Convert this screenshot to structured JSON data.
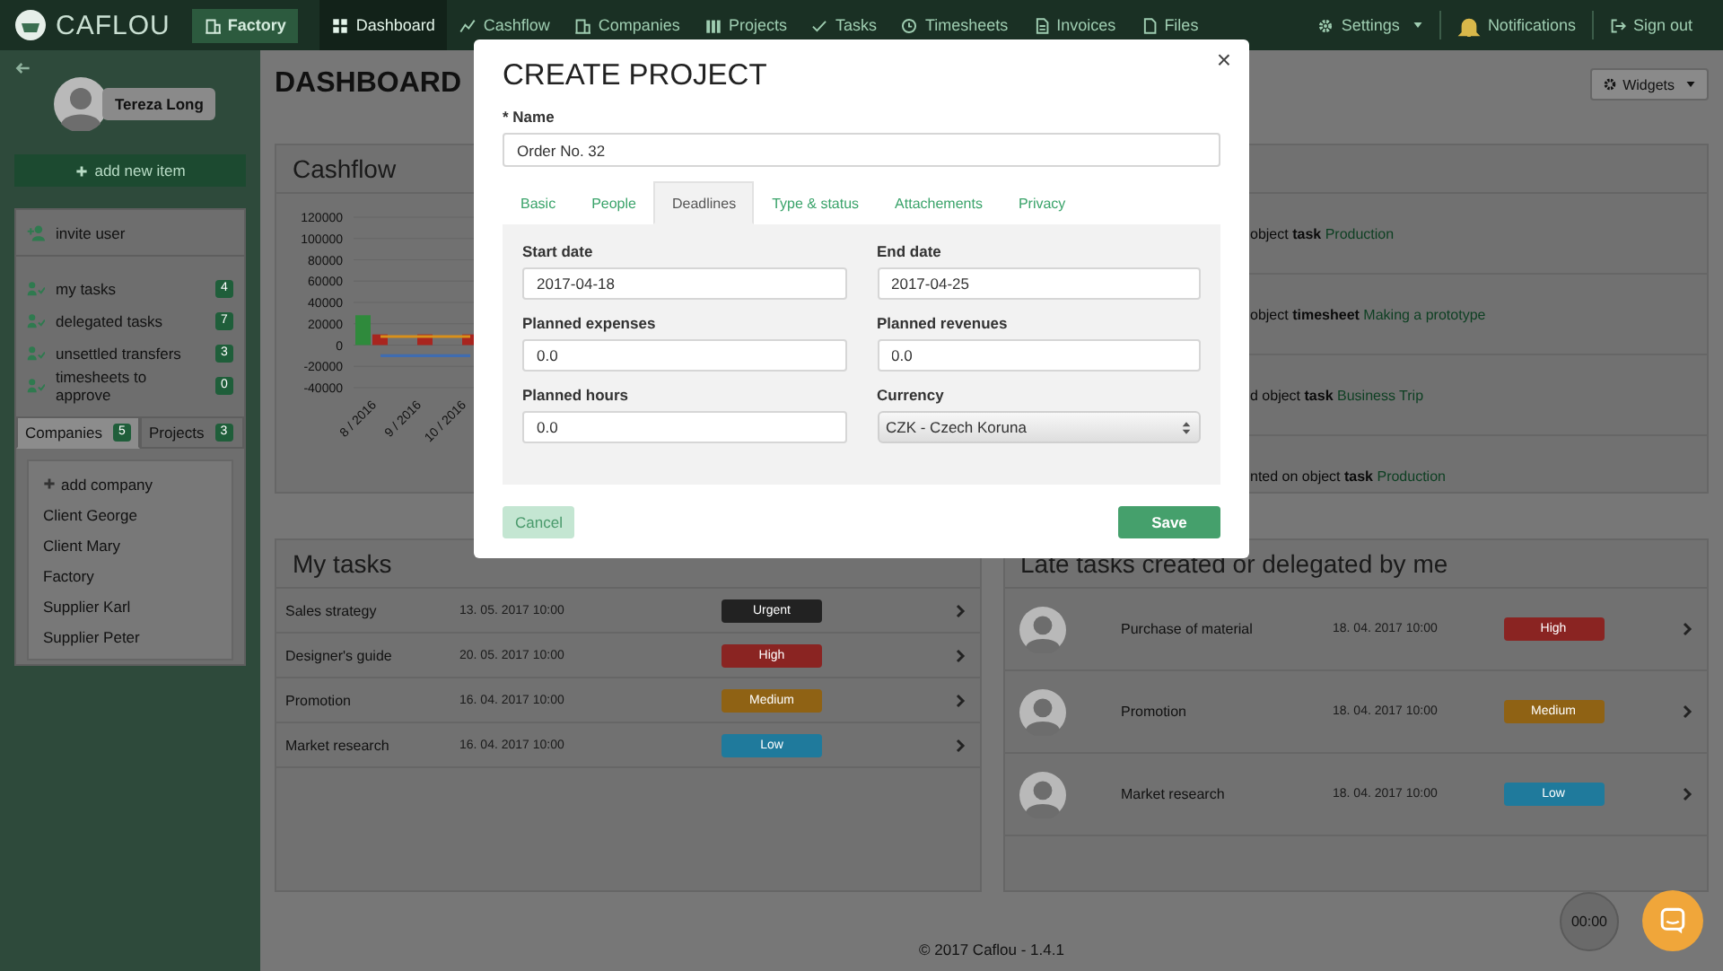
{
  "nav": {
    "logo": "CAFLOU",
    "company": "Factory",
    "items": [
      {
        "label": "Dashboard",
        "selected": true
      },
      {
        "label": "Cashflow",
        "selected": false
      },
      {
        "label": "Companies",
        "selected": false
      },
      {
        "label": "Projects",
        "selected": false
      },
      {
        "label": "Tasks",
        "selected": false
      },
      {
        "label": "Timesheets",
        "selected": false
      },
      {
        "label": "Invoices",
        "selected": false
      },
      {
        "label": "Files",
        "selected": false
      }
    ],
    "settings": "Settings",
    "notifications": "Notifications",
    "sign_out": "Sign out"
  },
  "sidebar": {
    "user": "Tereza Long",
    "add_button": "add new item",
    "invite": "invite user",
    "counters": [
      {
        "label": "my tasks",
        "count": "4"
      },
      {
        "label": "delegated tasks",
        "count": "7"
      },
      {
        "label": "unsettled transfers",
        "count": "3"
      },
      {
        "label": "timesheets to approve",
        "count": "0"
      }
    ],
    "tabs": [
      {
        "label": "Companies",
        "count": "5",
        "selected": true
      },
      {
        "label": "Projects",
        "count": "3",
        "selected": false
      }
    ],
    "add_company": "add company",
    "companies": [
      "Client George",
      "Client Mary",
      "Factory",
      "Supplier Karl",
      "Supplier Peter"
    ]
  },
  "main": {
    "title": "DASHBOARD",
    "widgets_button": "Widgets",
    "cashflow": {
      "title": "Cashflow",
      "chart_data": {
        "type": "bar",
        "categories": [
          "8 / 2016",
          "9 / 2016",
          "10 / 2016"
        ],
        "ylim": [
          -40000,
          120000
        ],
        "yticks": [
          120000,
          100000,
          80000,
          60000,
          40000,
          20000,
          0,
          -20000,
          -40000
        ],
        "stacked": false,
        "grid": true,
        "series": [
          {
            "color": "#2f8a3c",
            "values": [
              28000,
              0,
              0
            ]
          },
          {
            "color": "#a8251f",
            "values": [
              10000,
              10000,
              10000
            ]
          },
          {
            "type": "line",
            "color": "#d8901a",
            "values": [
              8000,
              8000,
              8000
            ]
          },
          {
            "type": "line",
            "color": "#3f6cb0",
            "values": [
              -10000,
              -10000,
              -10000
            ]
          }
        ]
      }
    },
    "activity": [
      {
        "text": "object **task**",
        "link": "Production"
      },
      {
        "text": "object **timesheet**",
        "link": "Making a prototype"
      },
      {
        "text": "d object **task**",
        "link": "Business Trip"
      },
      {
        "text": "nted on object **task**",
        "link": "Production"
      }
    ],
    "my_tasks": {
      "title": "My tasks",
      "rows": [
        {
          "name": "Sales strategy",
          "due": "13. 05. 2017 10:00",
          "priority": "Urgent",
          "color": "#222222"
        },
        {
          "name": "Designer's guide",
          "due": "20. 05. 2017 10:00",
          "priority": "High",
          "color": "#8a2422"
        },
        {
          "name": "Promotion",
          "due": "16. 04. 2017 10:00",
          "priority": "Medium",
          "color": "#8f6214"
        },
        {
          "name": "Market research",
          "due": "16. 04. 2017 10:00",
          "priority": "Low",
          "color": "#1f7a9c"
        }
      ]
    },
    "late_tasks": {
      "title": "Late tasks created or delegated by me",
      "rows": [
        {
          "name": "Purchase of material",
          "due": "18. 04. 2017 10:00",
          "priority": "High",
          "color": "#8a2422"
        },
        {
          "name": "Promotion",
          "due": "18. 04. 2017 10:00",
          "priority": "Medium",
          "color": "#8f6214"
        },
        {
          "name": "Market research",
          "due": "18. 04. 2017 10:00",
          "priority": "Low",
          "color": "#1f7a9c"
        }
      ]
    }
  },
  "footer": "© 2017 Caflou - 1.4.1",
  "timer": "00:00",
  "modal": {
    "title": "CREATE PROJECT",
    "close": "×",
    "name_label": "* Name",
    "name_value": "Order No. 32",
    "tabs": [
      {
        "label": "Basic",
        "selected": false
      },
      {
        "label": "People",
        "selected": false
      },
      {
        "label": "Deadlines",
        "selected": true
      },
      {
        "label": "Type & status",
        "selected": false
      },
      {
        "label": "Attachements",
        "selected": false
      },
      {
        "label": "Privacy",
        "selected": false
      }
    ],
    "fields": [
      {
        "kind": "input",
        "label": "Start date",
        "value": "2017-04-18"
      },
      {
        "kind": "input",
        "label": "End date",
        "value": "2017-04-25"
      },
      {
        "kind": "input",
        "label": "Planned expenses",
        "value": "0.0"
      },
      {
        "kind": "input",
        "label": "Planned revenues",
        "value": "0.0"
      },
      {
        "kind": "input",
        "label": "Planned hours",
        "value": "0.0"
      },
      {
        "kind": "select",
        "label": "Currency",
        "value": "CZK - Czech Koruna"
      }
    ],
    "cancel": "Cancel",
    "save": "Save"
  }
}
